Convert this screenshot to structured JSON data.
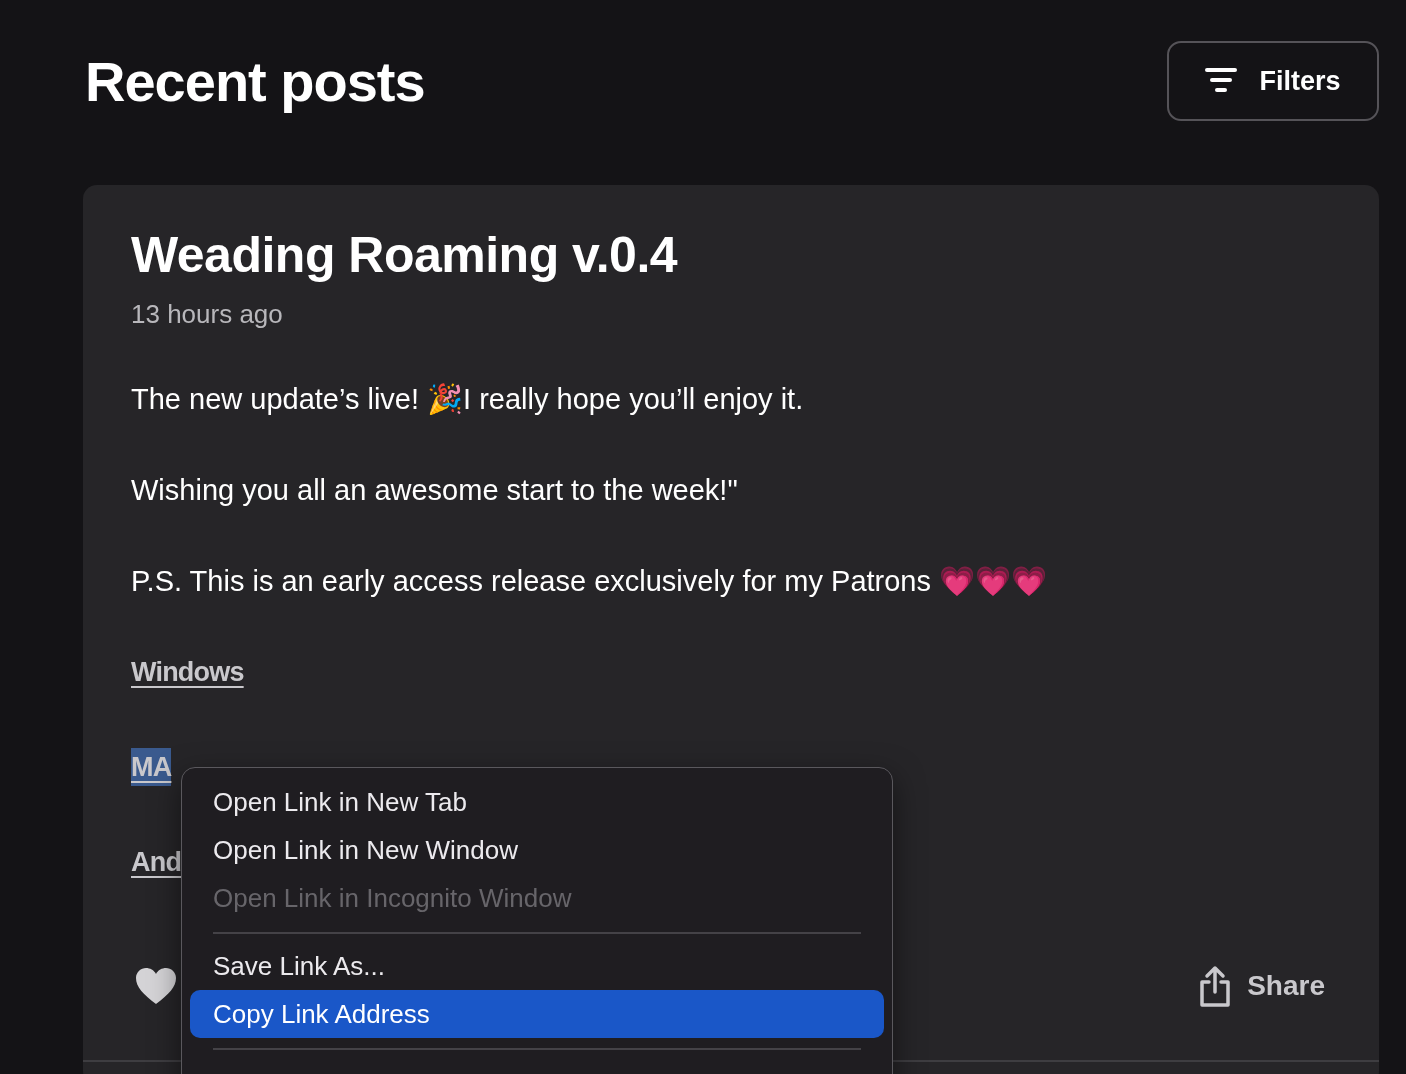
{
  "header": {
    "title": "Recent posts",
    "filters_button": "Filters"
  },
  "post": {
    "title": "Weading Roaming v.0.4",
    "time": "13 hours ago",
    "paragraphs": [
      "The new update’s live! 🎉I really hope you’ll enjoy it.",
      "Wishing you all an awesome start to the week!\"",
      "P.S. This is an early access release exclusively for my Patrons 💗💗💗"
    ],
    "links": [
      {
        "label": "Windows",
        "highlighted": false
      },
      {
        "label": "MA",
        "highlighted": true
      },
      {
        "label": "And",
        "highlighted": false
      }
    ],
    "share": "Share"
  },
  "context_menu": [
    {
      "kind": "item",
      "label": "Open Link in New Tab",
      "disabled": false,
      "selected": false
    },
    {
      "kind": "item",
      "label": "Open Link in New Window",
      "disabled": false,
      "selected": false
    },
    {
      "kind": "item",
      "label": "Open Link in Incognito Window",
      "disabled": true,
      "selected": false
    },
    {
      "kind": "separator"
    },
    {
      "kind": "item",
      "label": "Save Link As...",
      "disabled": false,
      "selected": false
    },
    {
      "kind": "item",
      "label": "Copy Link Address",
      "disabled": false,
      "selected": true
    },
    {
      "kind": "separator"
    }
  ]
}
